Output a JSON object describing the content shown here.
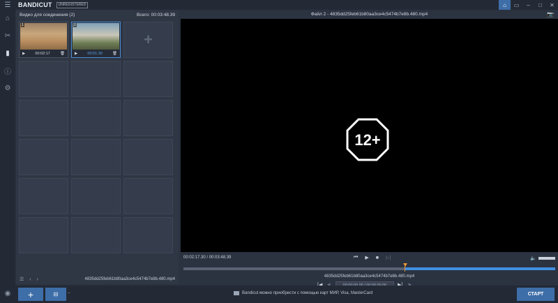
{
  "titlebar": {
    "logo_main": "BANDI",
    "logo_cut": "CUT",
    "unregistered": "UNREGISTERED"
  },
  "panel": {
    "title": "Видео для соединения (2)",
    "total": "Всего: 00:03:48.39",
    "clips": [
      {
        "num": "1",
        "duration": "00:02:17"
      },
      {
        "num": "2",
        "duration": "00:01:30"
      }
    ],
    "footer_filename": "4835dd25feb61b80aa3ce4c5474b7e8b.480.mp4"
  },
  "preview": {
    "title": "Файл 2 - 4835dd25feb61b80aa3ce4c5474b7e8b.480.mp4",
    "rating": "12+",
    "time": "00:02:17.30 / 00:03:48.39",
    "timeline_filename": "4835dd25feb61b80aa3ce4c5474b7e8b.480.mp4",
    "trim_time": "00:00:00.00 / 00:00:00.00",
    "playhead_fraction": 0.6
  },
  "bottombar": {
    "notice": "Bandicut можно приобрести с помощью карт МИР, Visa, MasterCard",
    "start_label": "СТАРТ"
  },
  "colors": {
    "accent": "#3e6ea8",
    "selection": "#3f8fe0",
    "playhead": "#e8953a"
  }
}
